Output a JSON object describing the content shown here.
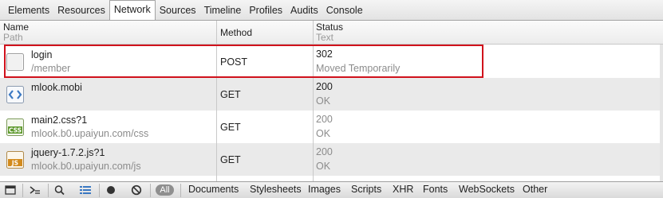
{
  "tabs": [
    "Elements",
    "Resources",
    "Network",
    "Sources",
    "Timeline",
    "Profiles",
    "Audits",
    "Console"
  ],
  "selected_tab": "Network",
  "columns": {
    "name": {
      "title": "Name",
      "subtitle": "Path"
    },
    "method": {
      "title": "Method"
    },
    "status": {
      "title": "Status",
      "subtitle": "Text"
    }
  },
  "rows": [
    {
      "name": "login",
      "path": "/member",
      "method": "POST",
      "status": "302",
      "status_text": "Moved Temporarily",
      "icon": "blank-document-icon"
    },
    {
      "name": "mlook.mobi",
      "path": "",
      "method": "GET",
      "status": "200",
      "status_text": "OK",
      "icon": "html-document-icon"
    },
    {
      "name": "main2.css?1",
      "path": "mlook.b0.upaiyun.com/css",
      "method": "GET",
      "status": "200",
      "status_text": "OK",
      "icon": "css-document-icon"
    },
    {
      "name": "jquery-1.7.2.js?1",
      "path": "mlook.b0.upaiyun.com/js",
      "method": "GET",
      "status": "200",
      "status_text": "OK",
      "icon": "js-document-icon"
    }
  ],
  "filters": {
    "all": "All",
    "types": [
      "Documents",
      "Stylesheets",
      "Images",
      "Scripts",
      "XHR",
      "Fonts",
      "WebSockets",
      "Other"
    ]
  },
  "colors": {
    "highlight": "#d0121c",
    "css_icon": "#5f9a2e",
    "js_icon": "#d28a1c",
    "html_icon": "#3a78c2"
  }
}
